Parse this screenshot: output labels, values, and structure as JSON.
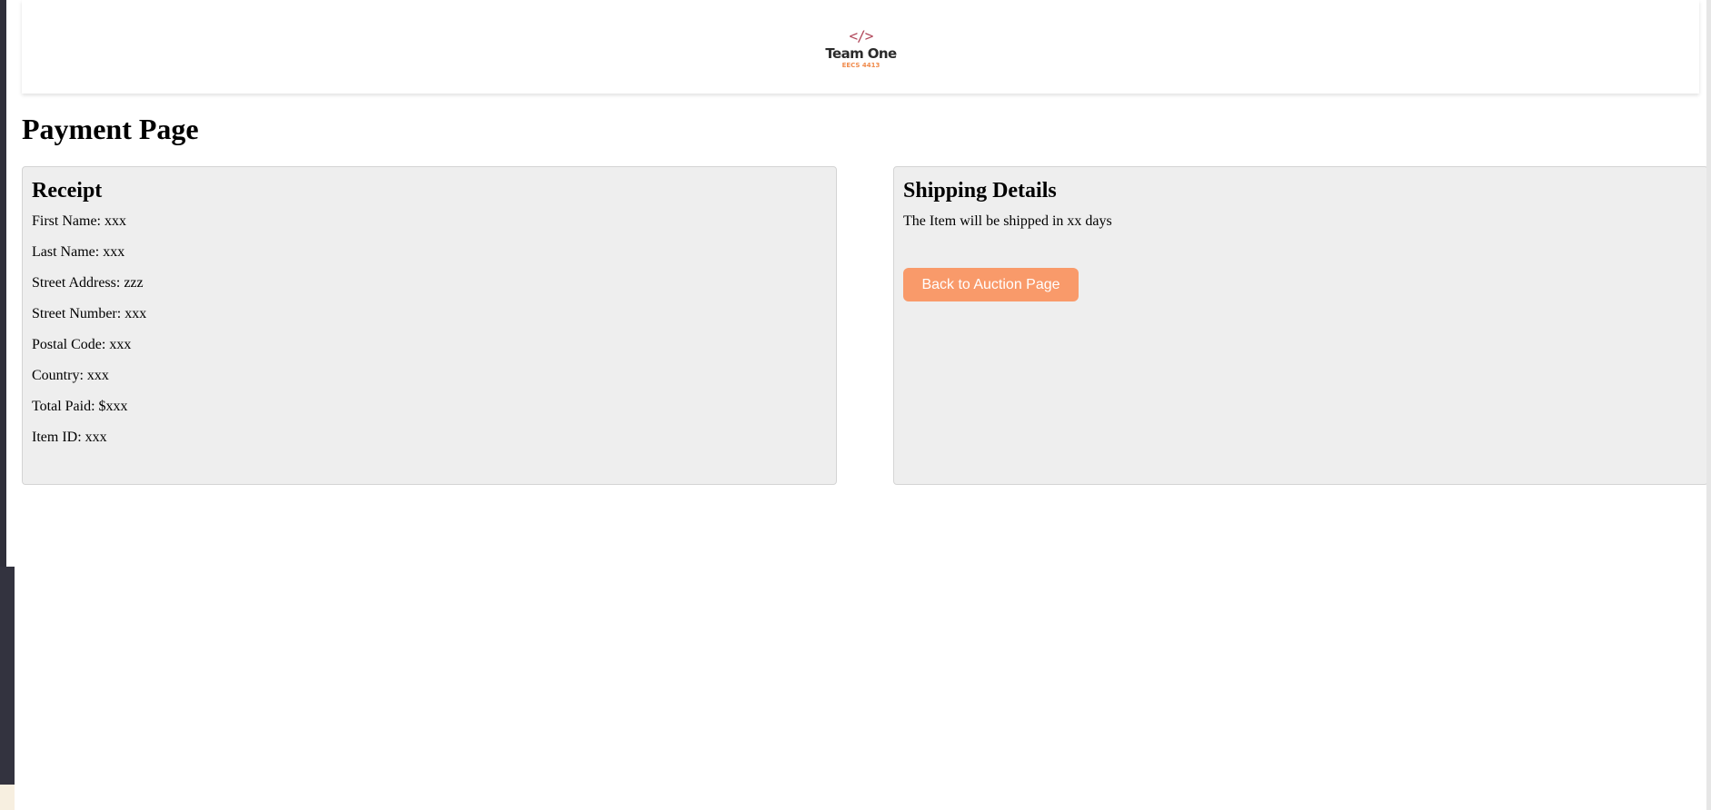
{
  "header": {
    "logo_icon": "</>",
    "logo_name": "Team One",
    "logo_sub": "EECS 4413"
  },
  "page_title": "Payment Page",
  "receipt": {
    "title": "Receipt",
    "rows": [
      "First Name: xxx",
      "Last Name: xxx",
      "Street Address: zzz",
      "Street Number: xxx",
      "Postal Code: xxx",
      "Country: xxx",
      "Total Paid: $xxx",
      "Item ID: xxx"
    ]
  },
  "shipping": {
    "title": "Shipping Details",
    "note": "The Item will be shipped in xx days",
    "back_button_label": "Back to Auction Page"
  },
  "colors": {
    "accent_button": "#f99a6a",
    "logo_icon": "#b2495c",
    "logo_sub": "#f08a4b",
    "card_background": "#eeeeee"
  }
}
